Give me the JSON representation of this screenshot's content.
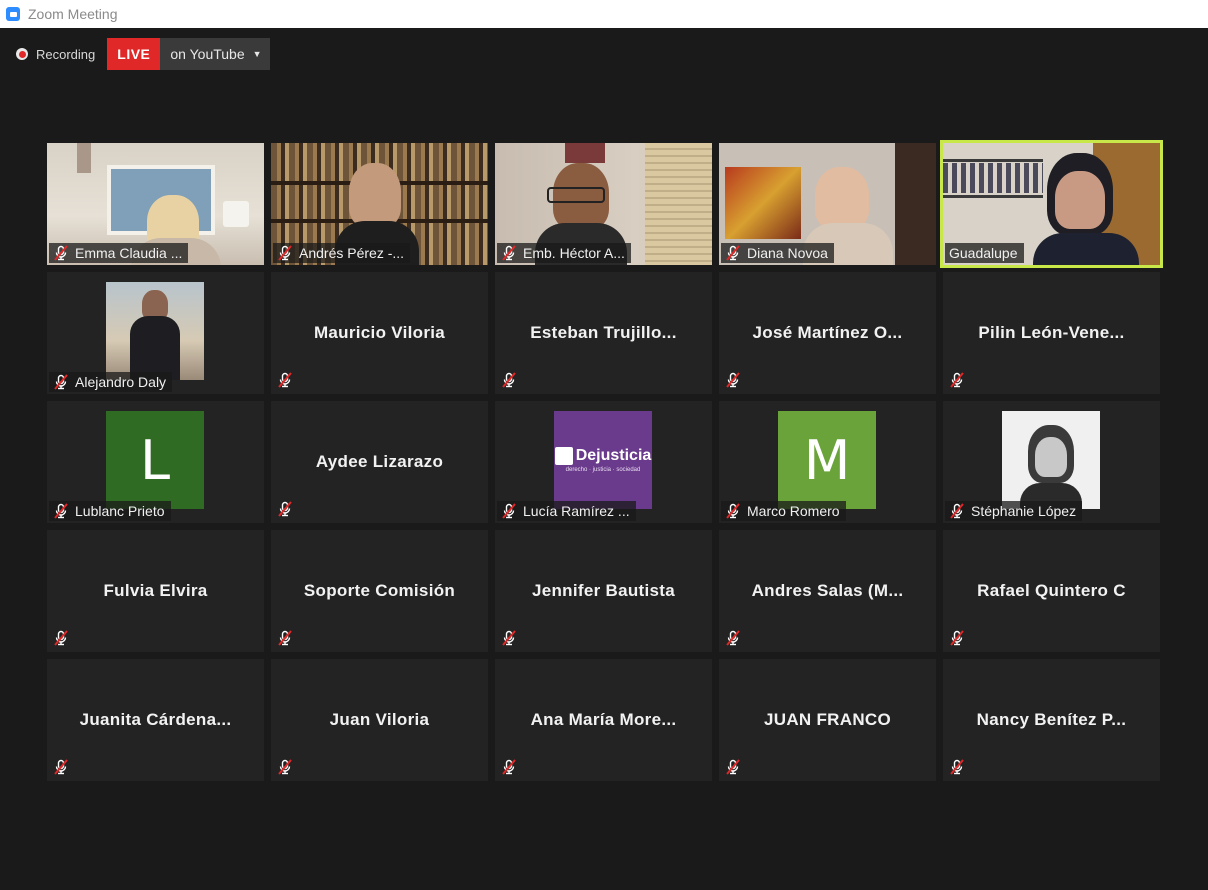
{
  "window": {
    "title": "Zoom Meeting"
  },
  "recording": {
    "label": "Recording",
    "live_label": "LIVE",
    "stream_target": "on YouTube",
    "colors": {
      "live": "#e02828"
    }
  },
  "participants": [
    {
      "name": "Emma Claudia ...",
      "kind": "video",
      "muted": true
    },
    {
      "name": "Andrés Pérez -...",
      "kind": "video",
      "muted": true
    },
    {
      "name": "Emb. Héctor A...",
      "kind": "video",
      "muted": true
    },
    {
      "name": "Diana Novoa",
      "kind": "video",
      "muted": true
    },
    {
      "name": "Guadalupe",
      "kind": "video",
      "muted": false,
      "active_speaker": true
    },
    {
      "name": "Alejandro Daly",
      "kind": "photo",
      "muted": true
    },
    {
      "name": "Mauricio Viloria",
      "kind": "name",
      "muted": true
    },
    {
      "name": "Esteban Trujillo...",
      "kind": "name",
      "muted": true
    },
    {
      "name": "José Martínez O...",
      "kind": "name",
      "muted": true
    },
    {
      "name": "Pilin León-Vene...",
      "kind": "name",
      "muted": true
    },
    {
      "name": "Lublanc Prieto",
      "kind": "letter",
      "letter": "L",
      "color": "#2f6b22",
      "muted": true
    },
    {
      "name": "Aydee Lizarazo",
      "kind": "name",
      "muted": true
    },
    {
      "name": "Lucía Ramírez ...",
      "kind": "logo",
      "logo_text": "Dejusticia",
      "logo_sub": "derecho · justicia · sociedad",
      "color": "#6a3a8c",
      "muted": true
    },
    {
      "name": "Marco Romero",
      "kind": "letter",
      "letter": "M",
      "color": "#6aa33a",
      "muted": true
    },
    {
      "name": "Stéphanie López",
      "kind": "photo",
      "muted": true
    },
    {
      "name": "Fulvia Elvira",
      "kind": "name",
      "muted": true
    },
    {
      "name": "Soporte Comisión",
      "kind": "name",
      "muted": true
    },
    {
      "name": "Jennifer Bautista",
      "kind": "name",
      "muted": true
    },
    {
      "name": "Andres Salas (M...",
      "kind": "name",
      "muted": true
    },
    {
      "name": "Rafael Quintero C",
      "kind": "name",
      "muted": true
    },
    {
      "name": "Juanita Cárdena...",
      "kind": "name",
      "muted": true
    },
    {
      "name": "Juan Viloria",
      "kind": "name",
      "muted": true
    },
    {
      "name": "Ana María More...",
      "kind": "name",
      "muted": true
    },
    {
      "name": "JUAN FRANCO",
      "kind": "name",
      "muted": true
    },
    {
      "name": "Nancy Benítez P...",
      "kind": "name",
      "muted": true
    }
  ],
  "colors": {
    "active_speaker_border": "#c8e84a",
    "tile_bg": "#232323",
    "app_bg": "#1a1a1a"
  }
}
